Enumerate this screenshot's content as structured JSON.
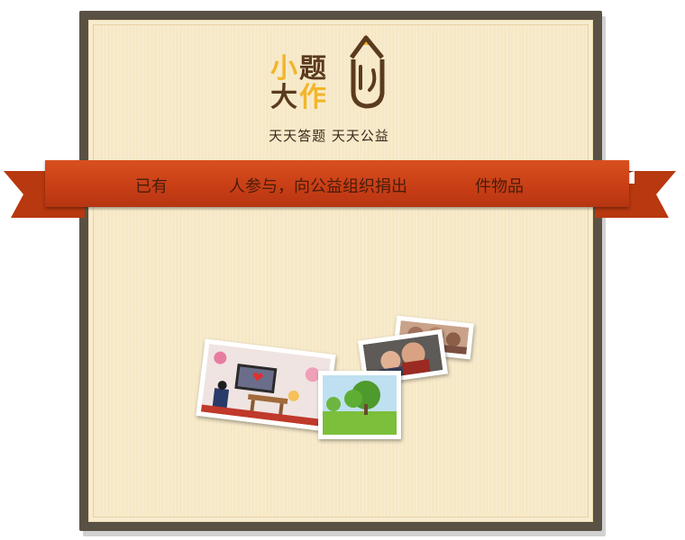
{
  "brand": {
    "logo_chars": [
      "小",
      "题",
      "大",
      "作"
    ],
    "slogan": "天天答题  天天公益"
  },
  "banner": {
    "prefix": "已有",
    "middle": "人参与，向公益组织捐出",
    "suffix": "件物品"
  },
  "photos": [
    {
      "name": "classroom-photo"
    },
    {
      "name": "park-photo"
    },
    {
      "name": "children-photo"
    },
    {
      "name": "group-photo"
    }
  ],
  "colors": {
    "frame": "#5a5145",
    "paper": "#f6e8c6",
    "ribbon": "#c93f16",
    "logo_yellow": "#f2b62a",
    "logo_brown": "#5b3a1e"
  }
}
